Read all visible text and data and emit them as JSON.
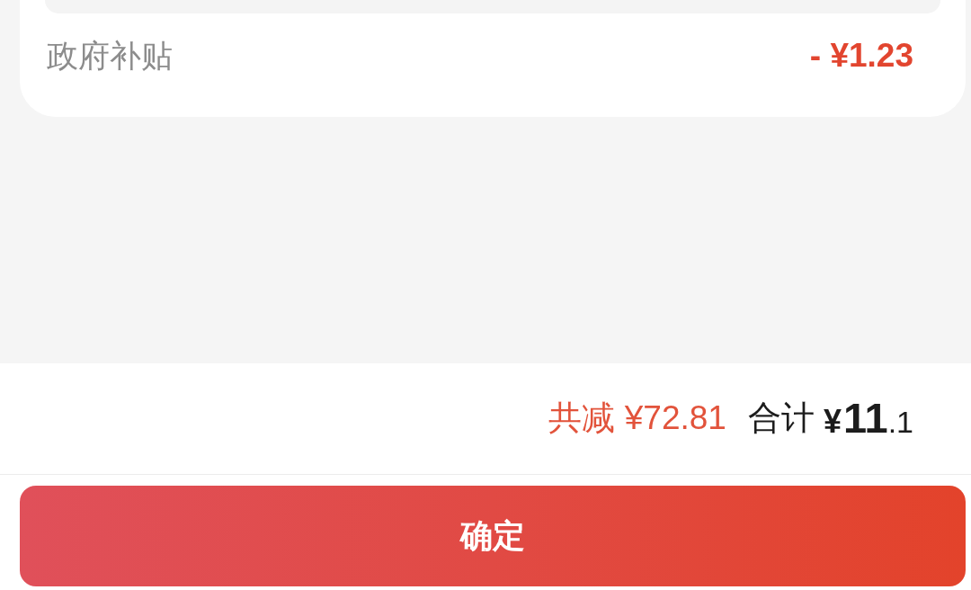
{
  "card": {
    "subsidy": {
      "label": "政府补贴",
      "amount": "- ¥1.23"
    }
  },
  "summary": {
    "discount": "共减 ¥72.81",
    "total": {
      "label": "合计",
      "currency": "¥",
      "integer": "11",
      "decimal": ".1"
    }
  },
  "confirm_button": {
    "label": "确定"
  }
}
